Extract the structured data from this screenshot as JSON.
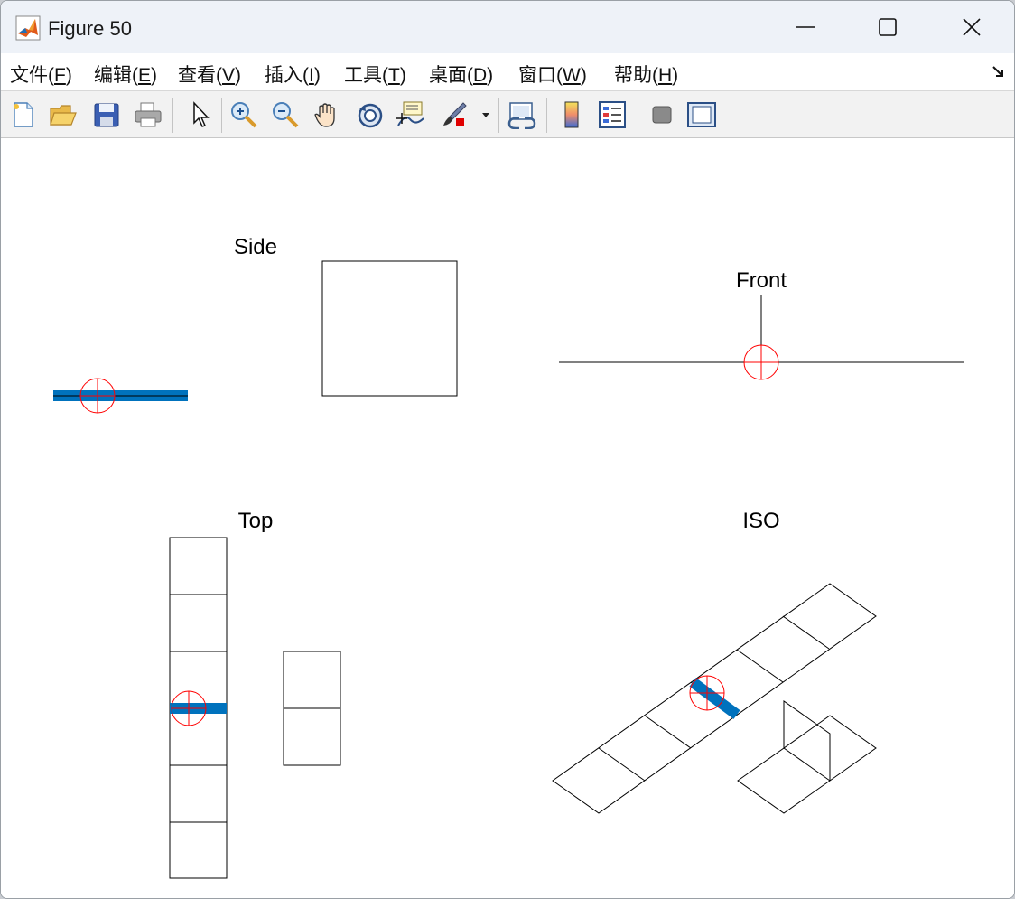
{
  "window": {
    "title": "Figure 50"
  },
  "menu": {
    "items": [
      {
        "label": "文件(",
        "key": "F",
        "suffix": ")"
      },
      {
        "label": "编辑(",
        "key": "E",
        "suffix": ")"
      },
      {
        "label": "查看(",
        "key": "V",
        "suffix": ")"
      },
      {
        "label": "插入(",
        "key": "I",
        "suffix": ")"
      },
      {
        "label": "工具(",
        "key": "T",
        "suffix": ")"
      },
      {
        "label": "桌面(",
        "key": "D",
        "suffix": ")"
      },
      {
        "label": "窗口(",
        "key": "W",
        "suffix": ")"
      },
      {
        "label": "帮助(",
        "key": "H",
        "suffix": ")"
      }
    ]
  },
  "toolbar": {
    "icons": [
      "new-figure-icon",
      "open-file-icon",
      "save-icon",
      "print-icon",
      "pointer-icon",
      "zoom-in-icon",
      "zoom-out-icon",
      "pan-hand-icon",
      "rotate-3d-icon",
      "data-cursor-icon",
      "brush-icon",
      "link-plot-icon",
      "colorbar-icon",
      "legend-icon",
      "hide-plot-tools-icon",
      "show-plot-tools-icon"
    ]
  },
  "plots": {
    "side_title": "Side",
    "front_title": "Front",
    "top_title": "Top",
    "iso_title": "ISO"
  },
  "colors": {
    "bar": "#0072bd",
    "target": "#ff0000",
    "line": "#000000"
  }
}
